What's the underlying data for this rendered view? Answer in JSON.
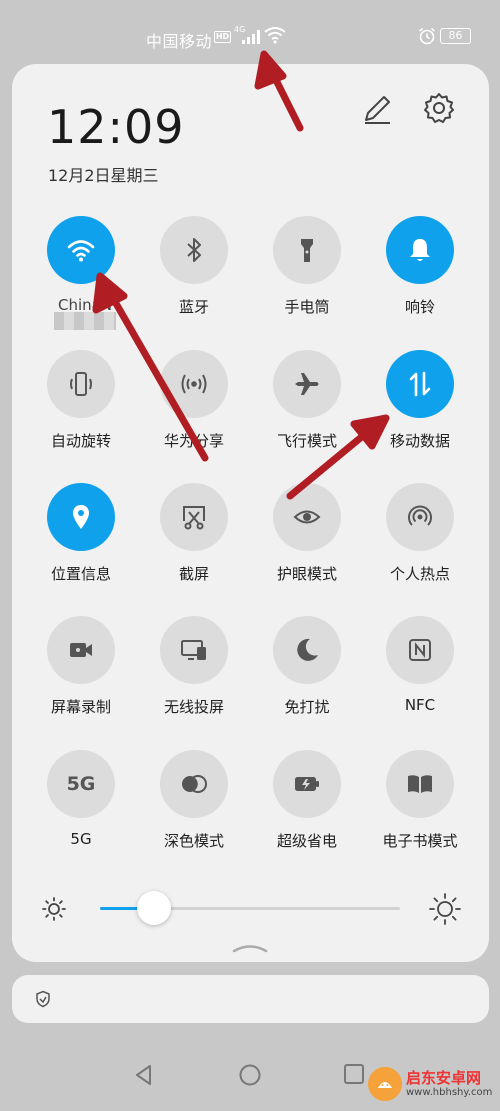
{
  "status_bar": {
    "carrier": "中国移动",
    "hd_badge": "HD",
    "network_type": "4G",
    "battery_level": "86"
  },
  "panel": {
    "time": "12:09",
    "date": "12月2日星期三"
  },
  "tiles": [
    {
      "label": "ChinaN",
      "icon": "wifi-icon",
      "on": true
    },
    {
      "label": "蓝牙",
      "icon": "bluetooth-icon",
      "on": false
    },
    {
      "label": "手电筒",
      "icon": "flashlight-icon",
      "on": false
    },
    {
      "label": "响铃",
      "icon": "bell-icon",
      "on": true
    },
    {
      "label": "自动旋转",
      "icon": "auto-rotate-icon",
      "on": false
    },
    {
      "label": "华为分享",
      "icon": "huawei-share-icon",
      "on": false
    },
    {
      "label": "飞行模式",
      "icon": "airplane-icon",
      "on": false
    },
    {
      "label": "移动数据",
      "icon": "mobile-data-icon",
      "on": true
    },
    {
      "label": "位置信息",
      "icon": "location-icon",
      "on": true
    },
    {
      "label": "截屏",
      "icon": "screenshot-icon",
      "on": false
    },
    {
      "label": "护眼模式",
      "icon": "eye-comfort-icon",
      "on": false
    },
    {
      "label": "个人热点",
      "icon": "hotspot-icon",
      "on": false
    },
    {
      "label": "屏幕录制",
      "icon": "screen-record-icon",
      "on": false
    },
    {
      "label": "无线投屏",
      "icon": "wireless-projection-icon",
      "on": false
    },
    {
      "label": "免打扰",
      "icon": "moon-icon",
      "on": false
    },
    {
      "label": "NFC",
      "icon": "nfc-icon",
      "on": false
    },
    {
      "label": "5G",
      "icon": "5g-icon",
      "icon_text": "5G",
      "on": false
    },
    {
      "label": "深色模式",
      "icon": "dark-mode-icon",
      "on": false
    },
    {
      "label": "超级省电",
      "icon": "battery-saver-icon",
      "on": false
    },
    {
      "label": "电子书模式",
      "icon": "ebook-icon",
      "on": false
    }
  ],
  "brightness": {
    "level_fraction": 0.18
  },
  "watermark": {
    "line1": "启东安卓网",
    "line2": "www.hbhshy.com"
  },
  "colors": {
    "accent": "#0fa1ec",
    "panel_bg": "#f1f1f1",
    "tile_off": "#dcdcdc",
    "annotation_arrow": "#b01e24"
  }
}
